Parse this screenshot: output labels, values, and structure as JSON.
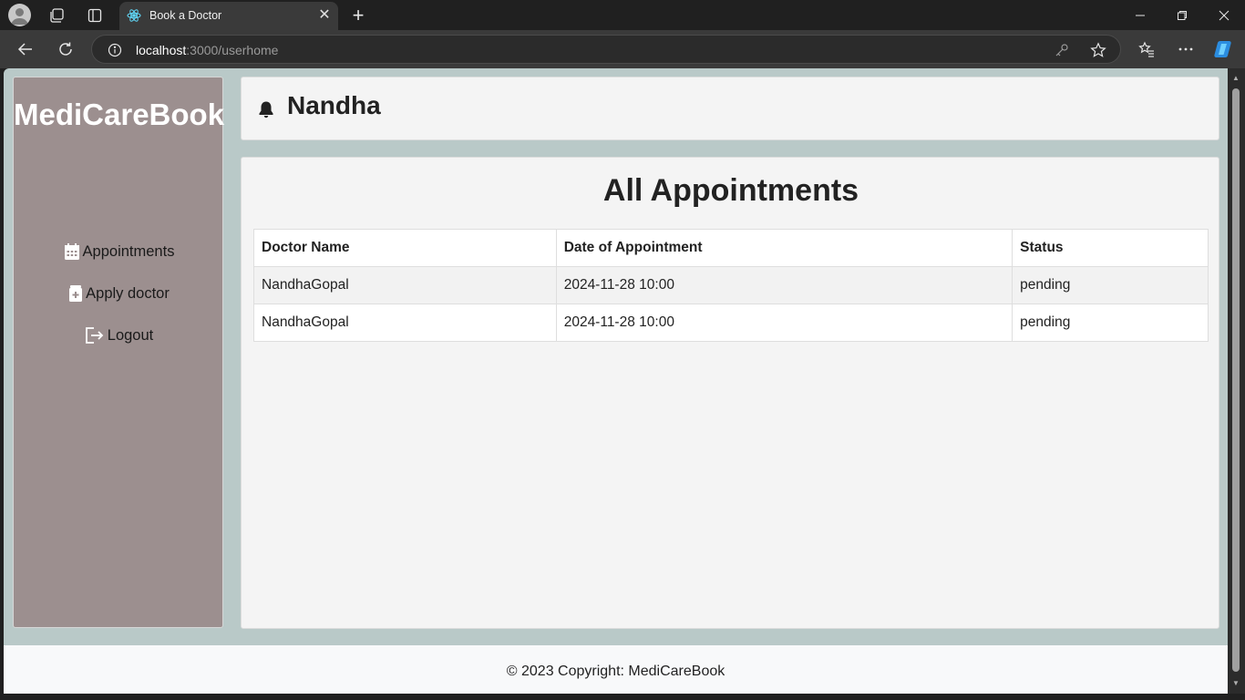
{
  "browser": {
    "tab_title": "Book a Doctor",
    "close_tab_glyph": "✕",
    "new_tab_glyph": "+",
    "url_host": "localhost",
    "url_rest": ":3000/userhome"
  },
  "app": {
    "brand": "MediCareBook",
    "sidebar": {
      "items": [
        {
          "label": "Appointments",
          "icon": "calendar-icon"
        },
        {
          "label": "Apply doctor",
          "icon": "medical-file-icon"
        },
        {
          "label": "Logout",
          "icon": "logout-icon"
        }
      ]
    },
    "header": {
      "username": "Nandha",
      "icon": "bell-icon"
    },
    "main": {
      "title": "All Appointments",
      "table": {
        "columns": [
          "Doctor Name",
          "Date of Appointment",
          "Status"
        ],
        "rows": [
          [
            "NandhaGopal",
            "2024-11-28 10:00",
            "pending"
          ],
          [
            "NandhaGopal",
            "2024-11-28 10:00",
            "pending"
          ]
        ]
      }
    },
    "footer": {
      "text": "© 2023 Copyright: MediCareBook"
    }
  },
  "colors": {
    "page_bg": "#b9c9c8",
    "sidebar_bg": "#9c8f8f",
    "card_bg": "#f4f4f4",
    "footer_bg": "#f8f9fa"
  }
}
